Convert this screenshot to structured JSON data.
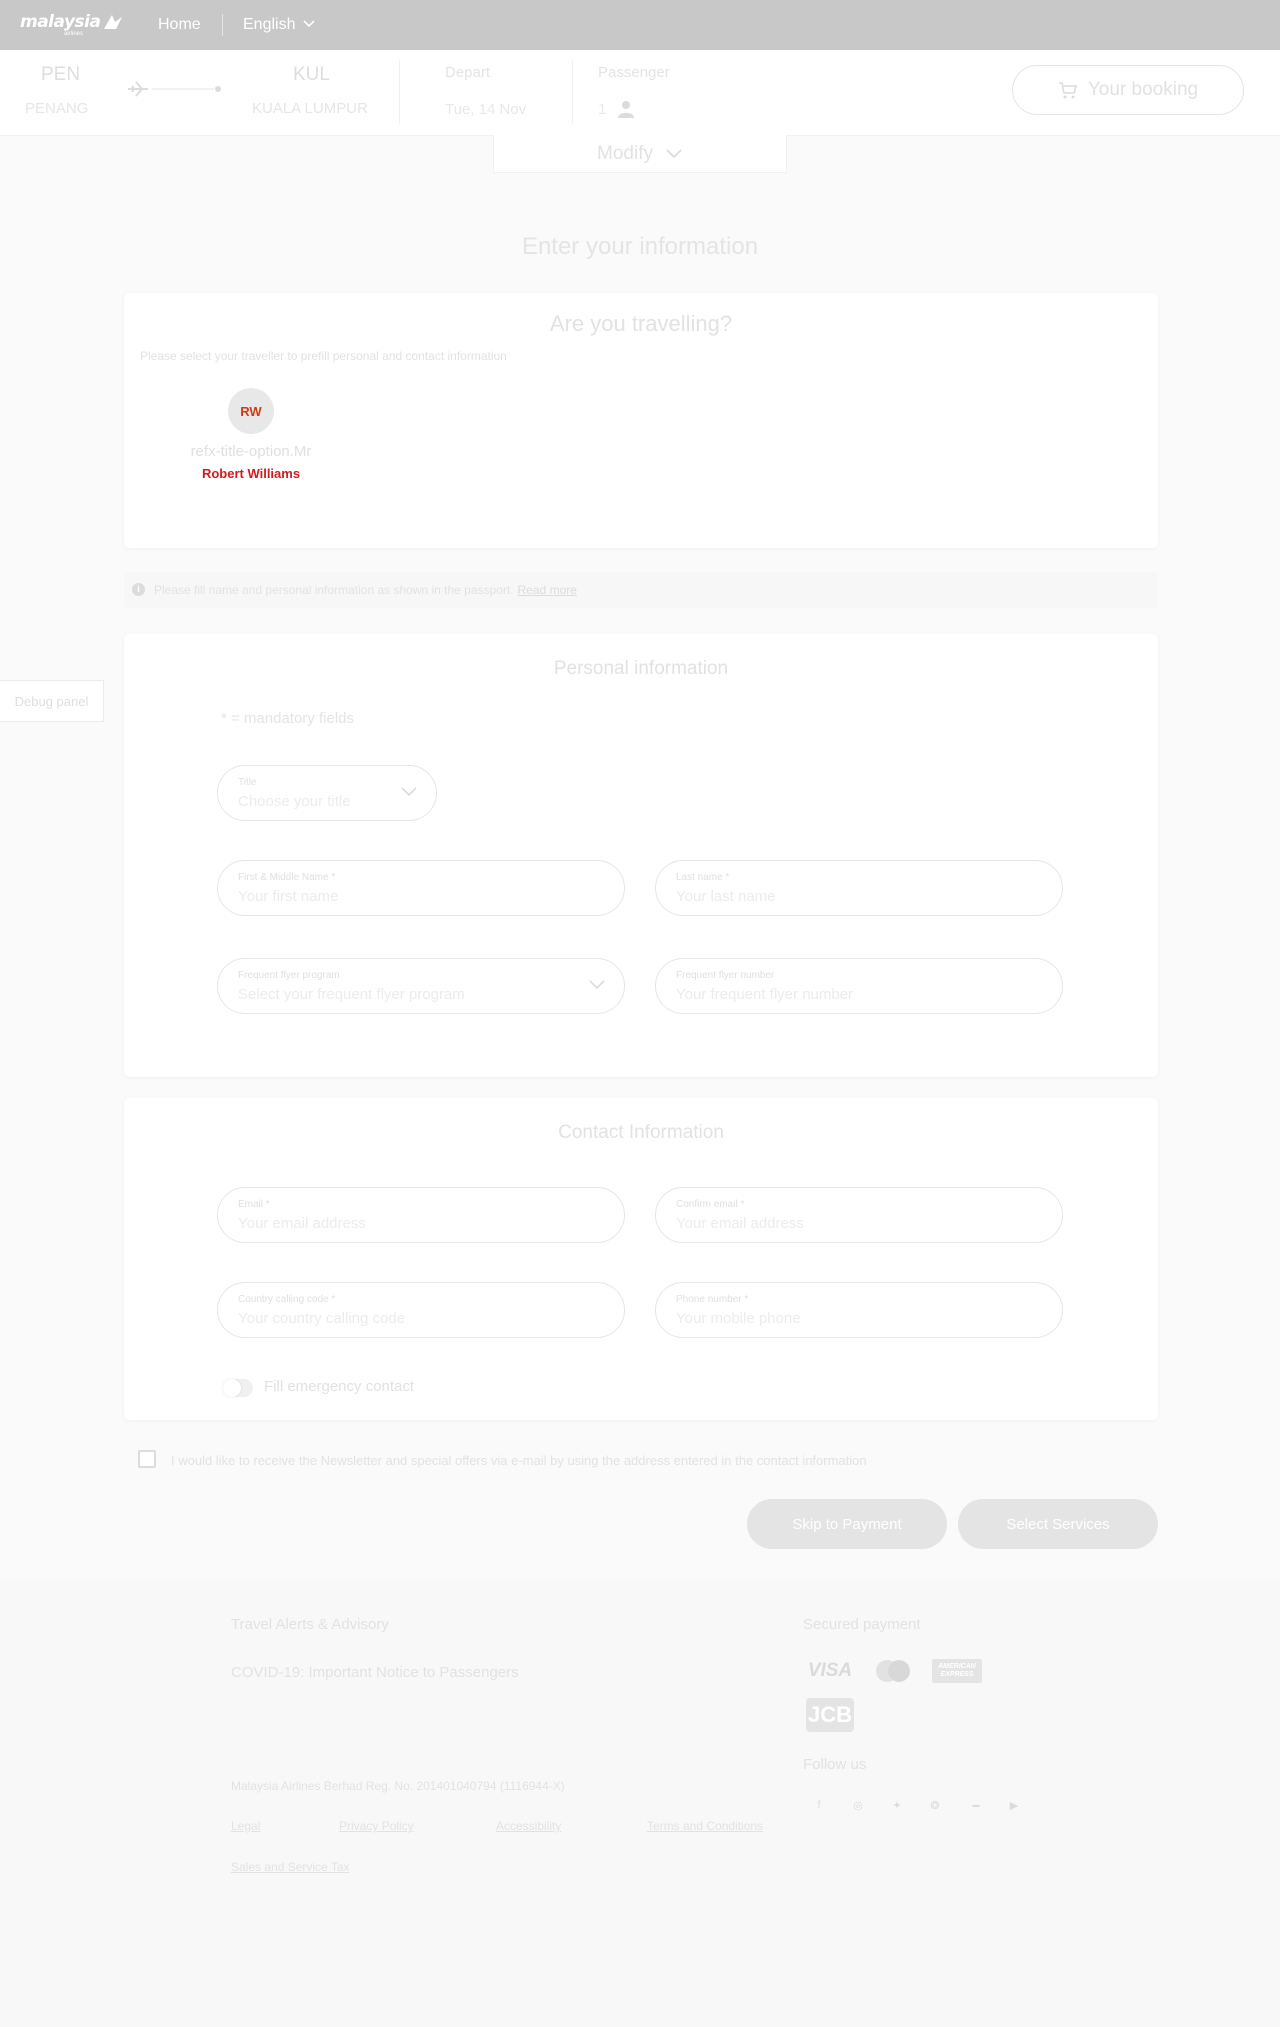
{
  "header": {
    "logo_text": "malaysia",
    "logo_sub": "airlines",
    "home": "Home",
    "language": "English"
  },
  "flight": {
    "origin_code": "PEN",
    "origin_city": "PENANG",
    "destination_code": "KUL",
    "destination_city": "KUALA LUMPUR",
    "depart_label": "Depart",
    "depart_value": "Tue, 14 Nov",
    "passenger_label": "Passenger",
    "passenger_value": "1",
    "booking_button": "Your booking",
    "modify": "Modify"
  },
  "page": {
    "title": "Enter your information"
  },
  "traveller": {
    "heading": "Are you travelling?",
    "hint": "Please select your traveller to prefill personal and contact information",
    "avatar_initials": "RW",
    "title_option": "refx-title-option.Mr",
    "name": "Robert Williams"
  },
  "notice": {
    "text": "Please fill name and personal information as shown in the passport.",
    "link": "Read more"
  },
  "debug": "Debug panel",
  "personal": {
    "heading": "Personal information",
    "mandatory": "* = mandatory fields",
    "title_label": "Title",
    "title_placeholder": "Choose your title",
    "first_label": "First & Middle Name *",
    "first_placeholder": "Your first name",
    "last_label": "Last name *",
    "last_placeholder": "Your last name",
    "ffp_label": "Frequent flyer program",
    "ffp_placeholder": "Select your frequent flyer program",
    "ffn_label": "Frequent flyer number",
    "ffn_placeholder": "Your frequent flyer number"
  },
  "contact": {
    "heading": "Contact Information",
    "email_label": "Email *",
    "email_placeholder": "Your email address",
    "confirm_label": "Confirm email *",
    "confirm_placeholder": "Your email address",
    "country_label": "Country calling code *",
    "country_placeholder": "Your country calling code",
    "phone_label": "Phone number *",
    "phone_placeholder": "Your mobile phone",
    "emergency_toggle": "Fill emergency contact"
  },
  "newsletter": "I would like to receive the Newsletter and special offers via e-mail by using the address entered in the contact information",
  "actions": {
    "skip": "Skip to Payment",
    "services": "Select Services"
  },
  "footer": {
    "alerts_heading": "Travel Alerts & Advisory",
    "covid": "COVID-19: Important Notice to Passengers",
    "reg": "Malaysia Airlines Berhad Reg. No. 201401040794 (1116944-X)",
    "links": [
      "Legal",
      "Privacy Policy",
      "Accessibility",
      "Terms and Conditions",
      "Sales and Service Tax"
    ],
    "secured_payment": "Secured payment",
    "pay_visa": "VISA",
    "pay_amex": "AMERICAN EXPRESS",
    "pay_jcb": "JCB",
    "follow_us": "Follow us",
    "social_icons": [
      "facebook-icon",
      "instagram-icon",
      "twitter-icon",
      "weibo-icon",
      "linkedin-icon",
      "youtube-icon"
    ]
  }
}
